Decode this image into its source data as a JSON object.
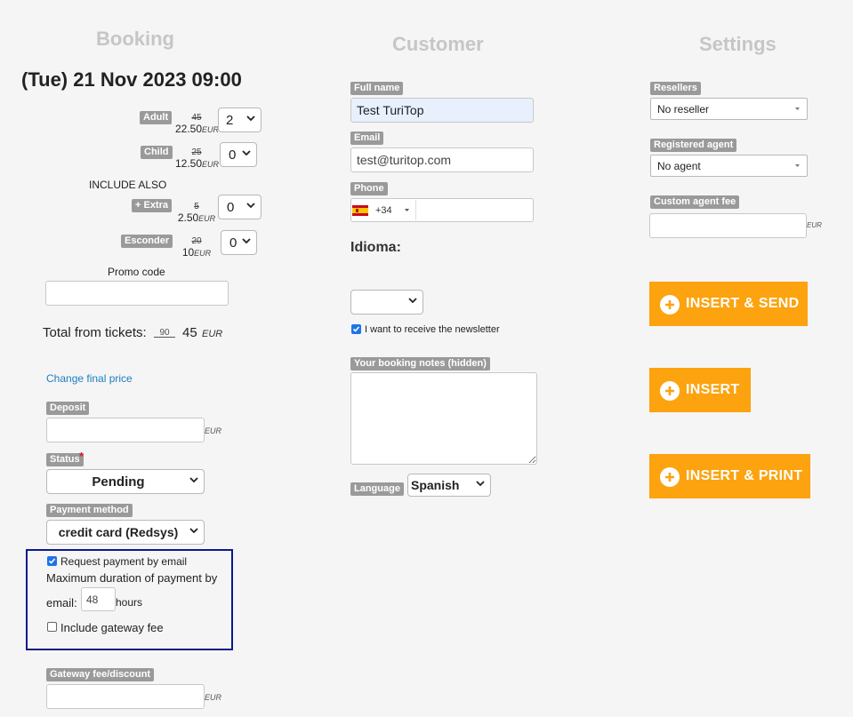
{
  "sections": {
    "booking": "Booking",
    "customer": "Customer",
    "settings": "Settings"
  },
  "booking": {
    "date": "(Tue) 21 Nov 2023 09:00",
    "tickets": [
      {
        "label": "Adult",
        "old_price": "45",
        "price": "22.50",
        "currency": "EUR",
        "qty": "2"
      },
      {
        "label": "Child",
        "old_price": "25",
        "price": "12.50",
        "currency": "EUR",
        "qty": "0"
      }
    ],
    "include_also": "INCLUDE ALSO",
    "extras": [
      {
        "label": "+ Extra",
        "old_price": "5",
        "price": "2.50",
        "currency": "EUR",
        "qty": "0"
      },
      {
        "label": "Esconder",
        "old_price": "20",
        "price": "10",
        "currency": "EUR",
        "qty": "0"
      }
    ],
    "promo_label": "Promo code",
    "promo_value": "",
    "total_label": "Total from tickets:",
    "total_old": "90",
    "total": "45",
    "total_currency": "EUR",
    "change_price_link": "Change final price",
    "deposit_label": "Deposit",
    "deposit_value": "",
    "deposit_currency": "EUR",
    "status_label": "Status",
    "status_required": "*",
    "status_value": "Pending",
    "payment_method_label": "Payment method",
    "payment_method_value": "credit card (Redsys)",
    "request_payment_label": "Request payment by email",
    "request_payment_checked": true,
    "max_duration_line1": "Maximum duration of payment by",
    "max_duration_prefix": "email:",
    "max_duration_value": "48",
    "max_duration_suffix": "hours",
    "gateway_fee_checkbox_label": "Include gateway fee",
    "gateway_fee_checked": false,
    "gateway_fee_label": "Gateway fee/discount",
    "gateway_fee_value": "",
    "gateway_fee_currency": "EUR",
    "highlight_color": "#0a1a8c"
  },
  "customer": {
    "full_name_label": "Full name",
    "full_name_value": "Test TuriTop",
    "email_label": "Email",
    "email_value": "test@turitop.com",
    "phone_label": "Phone",
    "phone_flag": "spain-flag-icon",
    "phone_code": "+34",
    "phone_value": "",
    "idioma_label": "Idioma:",
    "idioma_value": "",
    "newsletter_label": "I want to receive the newsletter",
    "newsletter_checked": true,
    "notes_label": "Your booking notes (hidden)",
    "notes_value": "",
    "language_label": "Language",
    "language_value": "Spanish"
  },
  "settings": {
    "resellers_label": "Resellers",
    "resellers_value": "No reseller",
    "agent_label": "Registered agent",
    "agent_value": "No agent",
    "fee_label": "Custom agent fee",
    "fee_value": "",
    "fee_currency": "EUR",
    "buttons": [
      "INSERT & SEND",
      "INSERT",
      "INSERT & PRINT"
    ],
    "button_color": "#fca30f"
  }
}
